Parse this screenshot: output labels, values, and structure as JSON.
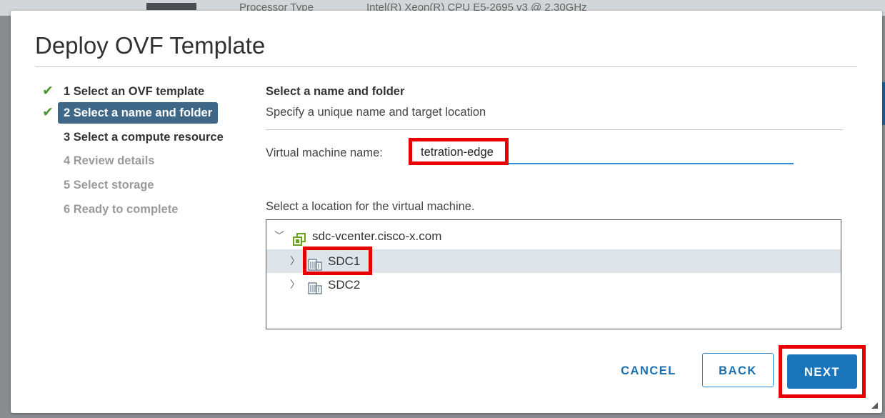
{
  "background": {
    "text1": "Processor Type",
    "text2": "Intel(R) Xeon(R) CPU E5-2695 v3 @ 2.30GHz"
  },
  "dialog": {
    "title": "Deploy OVF Template"
  },
  "steps": [
    {
      "label": "1 Select an OVF template",
      "state": "done"
    },
    {
      "label": "2 Select a name and folder",
      "state": "active"
    },
    {
      "label": "3 Select a compute resource",
      "state": "todo"
    },
    {
      "label": "4 Review details",
      "state": "disabled"
    },
    {
      "label": "5 Select storage",
      "state": "disabled"
    },
    {
      "label": "6 Ready to complete",
      "state": "disabled"
    }
  ],
  "content": {
    "section_title": "Select a name and folder",
    "section_subtitle": "Specify a unique name and target location",
    "vm_name_label": "Virtual machine name:",
    "vm_name_value": "tetration-edge",
    "location_label": "Select a location for the virtual machine."
  },
  "tree": {
    "root": {
      "label": "sdc-vcenter.cisco-x.com",
      "icon": "vcenter-icon",
      "expanded": true
    },
    "children": [
      {
        "label": "SDC1",
        "icon": "datacenter-icon",
        "selected": true
      },
      {
        "label": "SDC2",
        "icon": "datacenter-icon",
        "selected": false
      }
    ]
  },
  "buttons": {
    "cancel": "CANCEL",
    "back": "BACK",
    "next": "NEXT"
  },
  "colors": {
    "accent": "#1a75bb",
    "active_step": "#3f6888",
    "check": "#4b9a2e",
    "highlight": "#e60000",
    "selected_row": "#dde4ea"
  }
}
